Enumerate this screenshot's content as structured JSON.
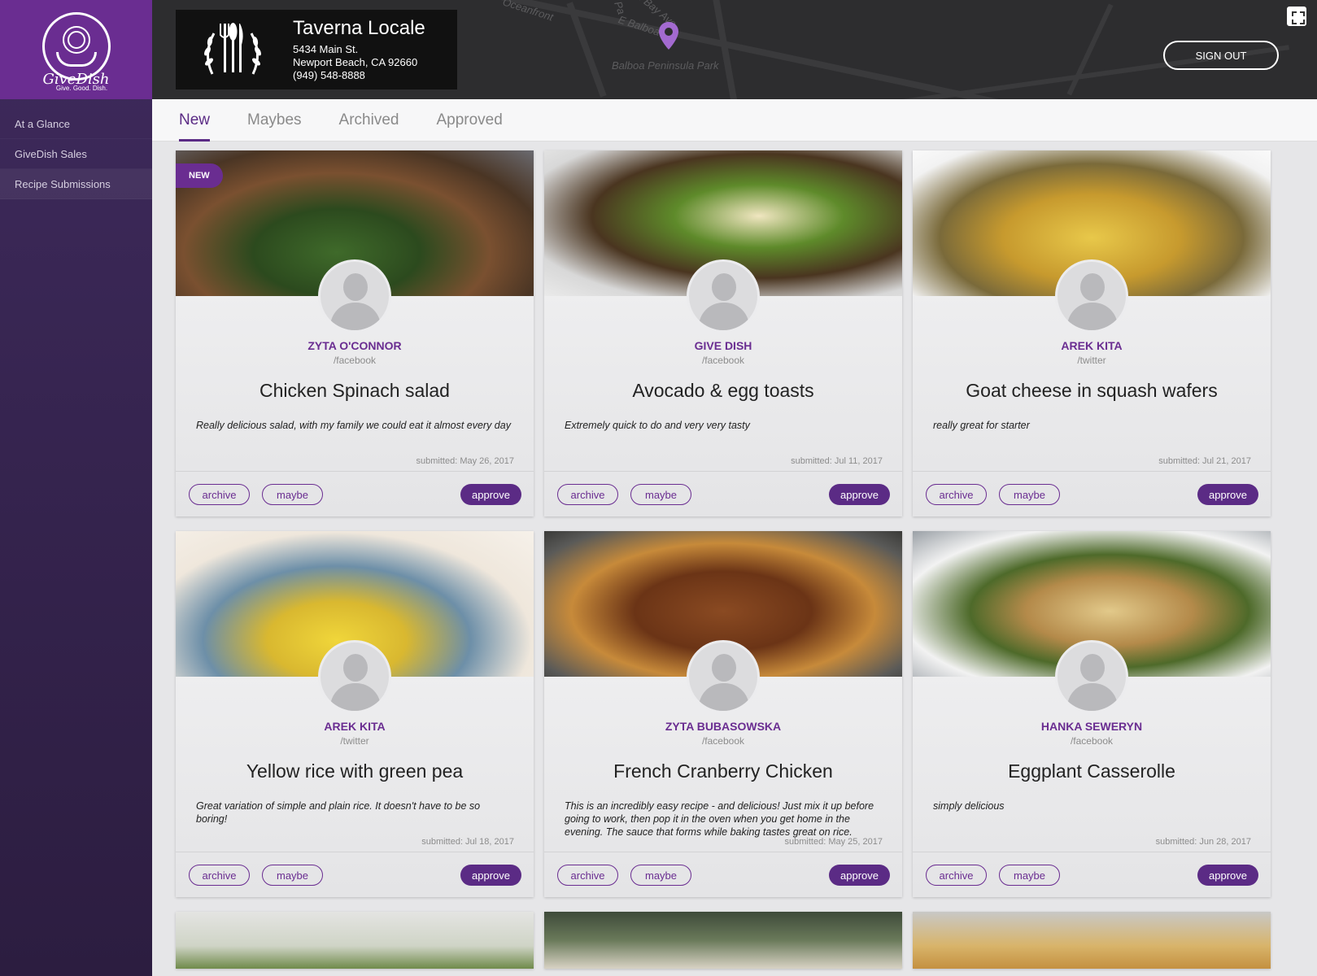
{
  "brand": {
    "logo_text": "GiveDish",
    "logo_tagline": "Give. Good. Dish."
  },
  "sidebar": {
    "items": [
      {
        "label": "At a Glance"
      },
      {
        "label": "GiveDish Sales"
      },
      {
        "label": "Recipe Submissions"
      }
    ]
  },
  "header": {
    "venue_name": "Taverna Locale",
    "address_line1": "5434 Main St.",
    "address_line2": "Newport Beach, CA 92660",
    "phone": "(949) 548-8888",
    "map_labels": [
      "Oceanfront",
      "E Balboa B",
      "E Bay Ave",
      "Balboa Peninsula Park",
      "Pa"
    ],
    "signout_label": "SIGN OUT",
    "colors": {
      "accent": "#6a2d91",
      "header_bg": "#2d2d2f"
    }
  },
  "tabs": [
    {
      "label": "New",
      "active": true
    },
    {
      "label": "Maybes"
    },
    {
      "label": "Archived"
    },
    {
      "label": "Approved"
    }
  ],
  "actions": {
    "archive": "archive",
    "maybe": "maybe",
    "approve": "approve"
  },
  "cards": [
    {
      "badge": "NEW",
      "author": "ZYTA O'CONNOR",
      "source": "/facebook",
      "title": "Chicken Spinach salad",
      "description": "Really delicious salad, with my family we could eat it almost every day",
      "submitted": "submitted: May 26, 2017"
    },
    {
      "author": "GIVE DISH",
      "source": "/facebook",
      "title": "Avocado & egg toasts",
      "description": "Extremely quick to do and very very tasty",
      "submitted": "submitted: Jul 11, 2017"
    },
    {
      "author": "AREK KITA",
      "source": "/twitter",
      "title": "Goat cheese in squash wafers",
      "description": "really great for starter",
      "submitted": "submitted: Jul 21, 2017"
    },
    {
      "author": "AREK KITA",
      "source": "/twitter",
      "title": "Yellow rice with green pea",
      "description": "Great variation of simple and plain rice. It doesn't have to be so boring!",
      "submitted": "submitted: Jul 18, 2017"
    },
    {
      "author": "ZYTA BUBASOWSKA",
      "source": "/facebook",
      "title": "French Cranberry Chicken",
      "description": "This is an incredibly easy recipe - and delicious! Just mix it up before going to work, then pop it in the oven when you get home in the evening. The sauce that forms while baking tastes great on rice.",
      "submitted": "submitted: May 25, 2017"
    },
    {
      "author": "HANKA SEWERYN",
      "source": "/facebook",
      "title": "Eggplant Casserolle",
      "description": "simply delicious",
      "submitted": "submitted: Jun 28, 2017"
    }
  ]
}
